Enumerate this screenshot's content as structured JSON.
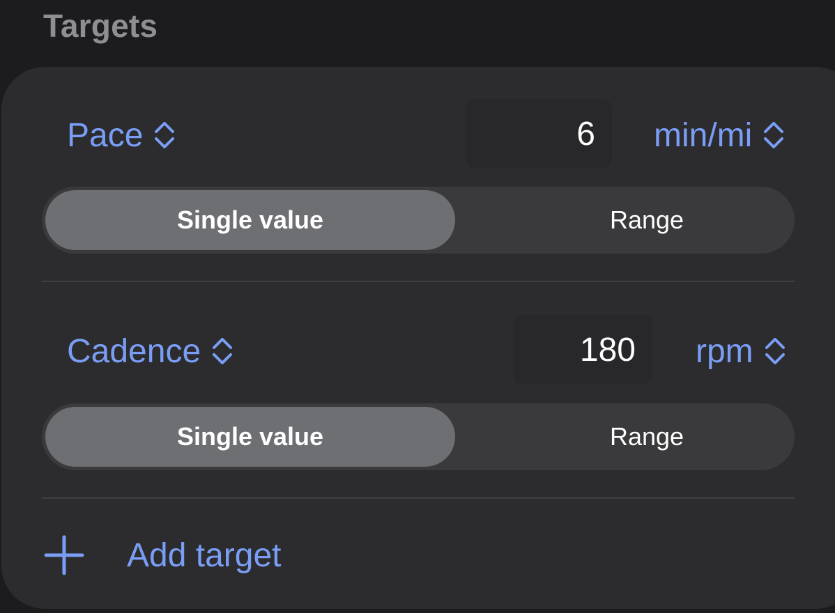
{
  "section": {
    "title": "Targets"
  },
  "targets": [
    {
      "metric": "Pace",
      "value": "6",
      "unit": "min/mi",
      "mode_options": [
        "Single value",
        "Range"
      ],
      "selected_mode": "Single value"
    },
    {
      "metric": "Cadence",
      "value": "180",
      "unit": "rpm",
      "mode_options": [
        "Single value",
        "Range"
      ],
      "selected_mode": "Single value"
    }
  ],
  "add_target": {
    "label": "Add target",
    "icon": "plus-icon"
  },
  "colors": {
    "accent": "#7a9ef5",
    "background": "#1c1c1e",
    "card": "#2c2c2e",
    "segment_selected": "#6e6f73"
  }
}
